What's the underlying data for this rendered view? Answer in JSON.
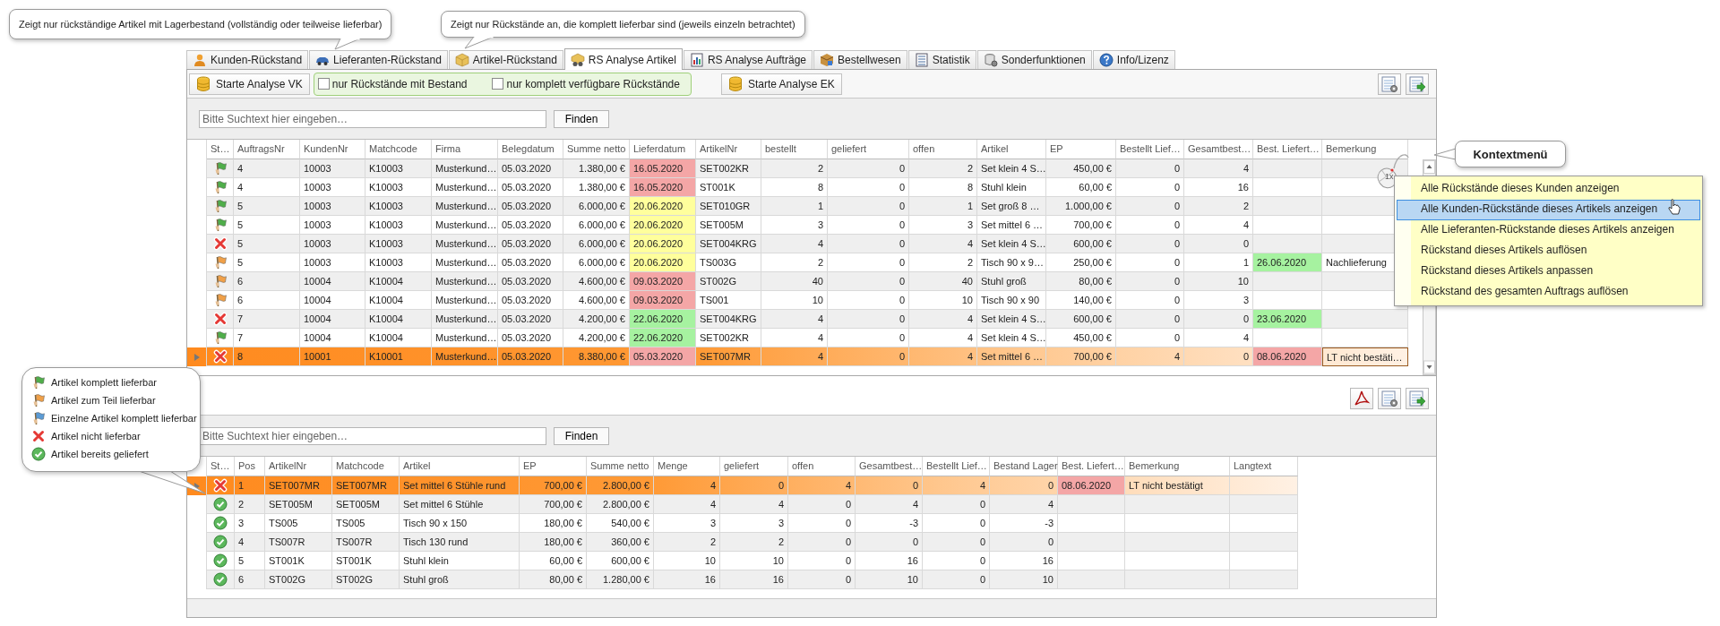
{
  "callouts": [
    {
      "text": "Zeigt nur rückständige Artikel mit Lagerbestand (vollständig oder teilweise lieferbar)"
    },
    {
      "text": "Zeigt nur Rückstände an, die komplett lieferbar sind (jeweils einzeln betrachtet)"
    }
  ],
  "tabs": [
    {
      "label": "Kunden-Rückstand",
      "kind": "person",
      "selected": false
    },
    {
      "label": "Lieferanten-Rückstand",
      "kind": "car",
      "selected": false
    },
    {
      "label": "Artikel-Rückstand",
      "kind": "box",
      "selected": false
    },
    {
      "label": "RS Analyse Artikel",
      "kind": "box-search",
      "selected": true
    },
    {
      "label": "RS Analyse Aufträge",
      "kind": "report",
      "selected": false
    },
    {
      "label": "Bestellwesen",
      "kind": "package",
      "selected": false
    },
    {
      "label": "Statistik",
      "kind": "table",
      "selected": false
    },
    {
      "label": "Sonderfunktionen",
      "kind": "database-gear",
      "selected": false
    },
    {
      "label": "Info/Lizenz",
      "kind": "help",
      "selected": false
    }
  ],
  "toolbar": {
    "start_vk": "Starte Analyse VK",
    "filters": [
      {
        "label": "nur Rückstände mit Bestand",
        "checked": false
      },
      {
        "label": "nur komplett verfügbare Rückstände",
        "checked": false
      }
    ],
    "start_ek": "Starte Analyse EK"
  },
  "upper": {
    "search": {
      "placeholder": "Bitte Suchtext hier eingeben…"
    },
    "find_button": "Finden",
    "columns": [
      "St…",
      "AuftragsNr",
      "KundenNr",
      "Matchcode",
      "Firma",
      "Belegdatum",
      "Summe netto",
      "Lieferdatum",
      "ArtikelNr",
      "bestellt",
      "geliefert",
      "offen",
      "Artikel",
      "EP",
      "Bestellt Lief…",
      "Gesamtbest…",
      "Best. Liefert…",
      "Bemerkung"
    ],
    "rows": [
      {
        "selected": false,
        "cells": [
          {
            "kind": "full"
          },
          "4",
          "10003",
          "K10003",
          "Musterkund…",
          "05.03.2020",
          "1.380,00 €",
          {
            "text": "16.05.2020",
            "color": "#f4a6a6"
          },
          "SET002KR",
          "2",
          "0",
          "2",
          "Set klein 4 S…",
          "450,00 €",
          "0",
          "4",
          null,
          null
        ]
      },
      {
        "selected": false,
        "cells": [
          {
            "kind": "full"
          },
          "4",
          "10003",
          "K10003",
          "Musterkund…",
          "05.03.2020",
          "1.380,00 €",
          {
            "text": "16.05.2020",
            "color": "#f4a6a6"
          },
          "ST001K",
          "8",
          "0",
          "8",
          "Stuhl klein",
          "60,00 €",
          "0",
          "16",
          null,
          null
        ]
      },
      {
        "selected": false,
        "cells": [
          {
            "kind": "full"
          },
          "5",
          "10003",
          "K10003",
          "Musterkund…",
          "05.03.2020",
          "6.000,00 €",
          {
            "text": "20.06.2020",
            "color": "#ffff9c"
          },
          "SET010GR",
          "1",
          "0",
          "1",
          "Set groß 8 …",
          "1.000,00 €",
          "0",
          "2",
          null,
          null
        ]
      },
      {
        "selected": false,
        "cells": [
          {
            "kind": "full"
          },
          "5",
          "10003",
          "K10003",
          "Musterkund…",
          "05.03.2020",
          "6.000,00 €",
          {
            "text": "20.06.2020",
            "color": "#ffff9c"
          },
          "SET005M",
          "3",
          "0",
          "3",
          "Set mittel 6 …",
          "700,00 €",
          "0",
          "4",
          null,
          null
        ]
      },
      {
        "selected": false,
        "cells": [
          {
            "kind": "none"
          },
          "5",
          "10003",
          "K10003",
          "Musterkund…",
          "05.03.2020",
          "6.000,00 €",
          {
            "text": "20.06.2020",
            "color": "#ffff9c"
          },
          "SET004KRG",
          "4",
          "0",
          "4",
          "Set klein 4 S…",
          "600,00 €",
          "0",
          "0",
          null,
          null
        ]
      },
      {
        "selected": false,
        "cells": [
          {
            "kind": "partial"
          },
          "5",
          "10003",
          "K10003",
          "Musterkund…",
          "05.03.2020",
          "6.000,00 €",
          {
            "text": "20.06.2020",
            "color": "#ffff9c"
          },
          "TS003G",
          "2",
          "0",
          "2",
          "Tisch 90 x 9…",
          "250,00 €",
          "0",
          "1",
          {
            "text": "26.06.2020",
            "color": "#a6f2a0"
          },
          "Nachlieferung"
        ]
      },
      {
        "selected": false,
        "cells": [
          {
            "kind": "partial"
          },
          "6",
          "10004",
          "K10004",
          "Musterkund…",
          "05.03.2020",
          "4.600,00 €",
          {
            "text": "09.03.2020",
            "color": "#f4a6a6"
          },
          "ST002G",
          "40",
          "0",
          "40",
          "Stuhl groß",
          "80,00 €",
          "0",
          "10",
          null,
          null
        ]
      },
      {
        "selected": false,
        "cells": [
          {
            "kind": "partial"
          },
          "6",
          "10004",
          "K10004",
          "Musterkund…",
          "05.03.2020",
          "4.600,00 €",
          {
            "text": "09.03.2020",
            "color": "#f4a6a6"
          },
          "TS001",
          "10",
          "0",
          "10",
          "Tisch 90 x 90",
          "140,00 €",
          "0",
          "3",
          null,
          null
        ]
      },
      {
        "selected": false,
        "cells": [
          {
            "kind": "none"
          },
          "7",
          "10004",
          "K10004",
          "Musterkund…",
          "05.03.2020",
          "4.200,00 €",
          {
            "text": "22.06.2020",
            "color": "#a6f2a0"
          },
          "SET004KRG",
          "4",
          "0",
          "4",
          "Set klein 4 S…",
          "600,00 €",
          "0",
          "0",
          {
            "text": "23.06.2020",
            "color": "#a6f2a0"
          },
          null
        ]
      },
      {
        "selected": false,
        "cells": [
          {
            "kind": "full"
          },
          "7",
          "10004",
          "K10004",
          "Musterkund…",
          "05.03.2020",
          "4.200,00 €",
          {
            "text": "22.06.2020",
            "color": "#a6f2a0"
          },
          "SET002KR",
          "4",
          "0",
          "4",
          "Set klein 4 S…",
          "450,00 €",
          "0",
          "4",
          null,
          null
        ]
      },
      {
        "selected": true,
        "cells": [
          {
            "kind": "none"
          },
          "8",
          "10001",
          "K10001",
          "Musterkund…",
          "05.03.2020",
          "8.380,00 €",
          {
            "text": "05.03.2020",
            "color": "#f4a6a6"
          },
          "SET007MR",
          "4",
          "0",
          "4",
          "Set mittel 6 …",
          "700,00 €",
          "4",
          "0",
          {
            "text": "08.06.2020",
            "color": "#f4a6a6"
          },
          {
            "text": "LT nicht bestäti…",
            "focused": true
          }
        ]
      }
    ]
  },
  "context_callout": "Kontextmenü",
  "mouse_label": "1x",
  "context_menu": [
    {
      "label": "Alle Rückstände dieses Kunden anzeigen",
      "selected": false
    },
    {
      "label": "Alle Kunden-Rückstände dieses Artikels anzeigen",
      "selected": true
    },
    {
      "label": "Alle Lieferanten-Rückstande dieses Artikels anzeigen",
      "selected": false
    },
    {
      "label": "Rückstand dieses Artikels auflösen",
      "selected": false
    },
    {
      "label": "Rückstand dieses Artikels anpassen",
      "selected": false
    },
    {
      "label": "Rückstand des gesamten Auftrags auflösen",
      "selected": false
    }
  ],
  "legend": [
    {
      "kind": "full",
      "label": "Artikel komplett lieferbar"
    },
    {
      "kind": "partial",
      "label": "Artikel zum Teil lieferbar"
    },
    {
      "kind": "single",
      "label": "Einzelne Artikel komplett lieferbar"
    },
    {
      "kind": "none",
      "label": "Artikel nicht lieferbar"
    },
    {
      "kind": "delivered",
      "label": "Artikel bereits geliefert"
    }
  ],
  "lower": {
    "search": {
      "placeholder": "Bitte Suchtext hier eingeben…"
    },
    "find_button": "Finden",
    "columns": [
      "St…",
      "Pos",
      "ArtikelNr",
      "Matchcode",
      "Artikel",
      "EP",
      "Summe netto",
      "Menge",
      "geliefert",
      "offen",
      "Gesamtbest…",
      "Bestellt Lief…",
      "Bestand Lager",
      "Best. Liefert…",
      "Bemerkung",
      "Langtext"
    ],
    "rows": [
      {
        "selected": true,
        "cells": [
          {
            "kind": "none"
          },
          "1",
          "SET007MR",
          "SET007MR",
          "Set mittel 6 Stühle rund",
          "700,00 €",
          "2.800,00 €",
          "4",
          "0",
          "4",
          "0",
          "4",
          "0",
          {
            "text": "08.06.2020",
            "color": "#f4a6a6"
          },
          "LT nicht bestätigt",
          null
        ]
      },
      {
        "selected": false,
        "cells": [
          {
            "kind": "delivered"
          },
          "2",
          "SET005M",
          "SET005M",
          "Set mittel 6 Stühle",
          "700,00 €",
          "2.800,00 €",
          "4",
          "4",
          "0",
          "4",
          "0",
          "4",
          null,
          null,
          null
        ]
      },
      {
        "selected": false,
        "cells": [
          {
            "kind": "delivered"
          },
          "3",
          "TS005",
          "TS005",
          "Tisch 90 x 150",
          "180,00 €",
          "540,00 €",
          "3",
          "3",
          "0",
          "-3",
          "0",
          "-3",
          null,
          null,
          null
        ]
      },
      {
        "selected": false,
        "cells": [
          {
            "kind": "delivered"
          },
          "4",
          "TS007R",
          "TS007R",
          "Tisch 130 rund",
          "180,00 €",
          "360,00 €",
          "2",
          "2",
          "0",
          "0",
          "0",
          "0",
          null,
          null,
          null
        ]
      },
      {
        "selected": false,
        "cells": [
          {
            "kind": "delivered"
          },
          "5",
          "ST001K",
          "ST001K",
          "Stuhl klein",
          "60,00 €",
          "600,00 €",
          "10",
          "10",
          "0",
          "16",
          "0",
          "16",
          null,
          null,
          null
        ]
      },
      {
        "selected": false,
        "cells": [
          {
            "kind": "delivered"
          },
          "6",
          "ST002G",
          "ST002G",
          "Stuhl groß",
          "80,00 €",
          "1.280,00 €",
          "16",
          "16",
          "0",
          "10",
          "0",
          "10",
          null,
          null,
          null
        ]
      }
    ]
  }
}
